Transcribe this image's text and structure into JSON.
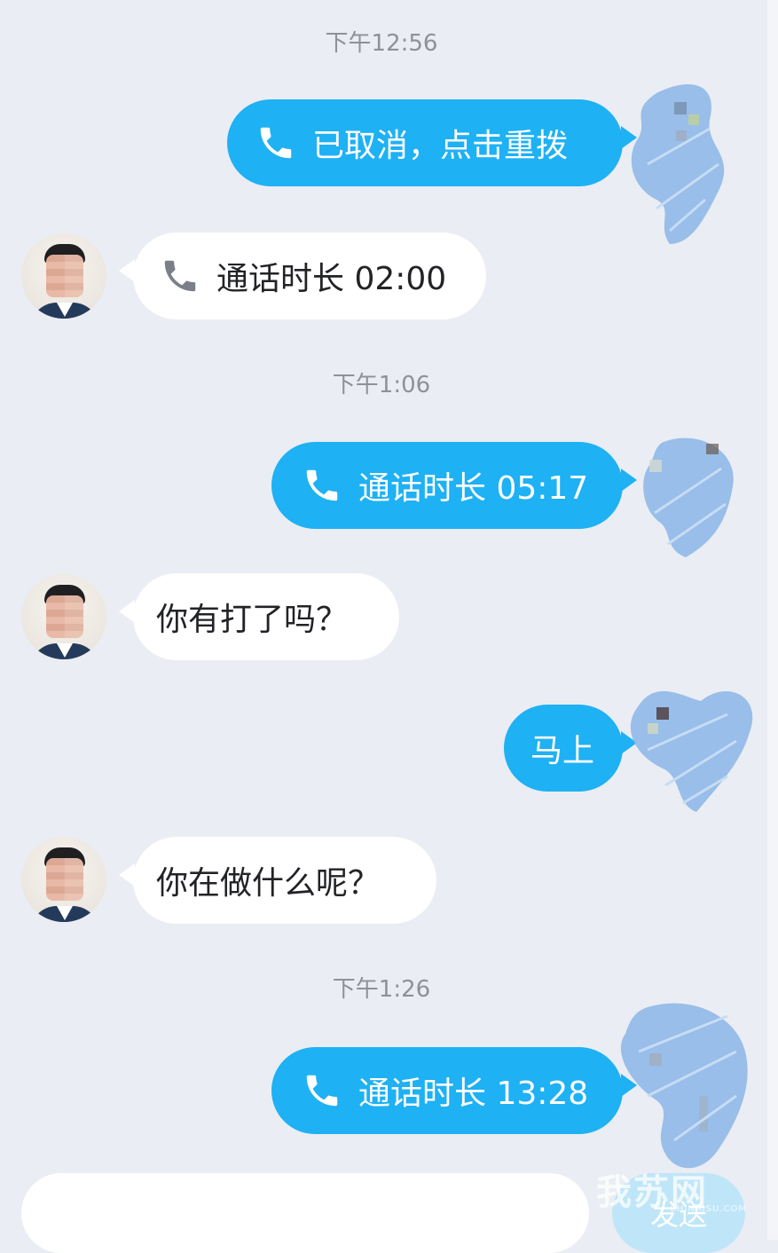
{
  "chat": {
    "timestamps": [
      "下午12:56",
      "下午1:06",
      "下午1:26"
    ],
    "messages": {
      "m1": "已取消，点击重拨",
      "m2": "通话时长 02:00",
      "m3": "通话时长 05:17",
      "m4": "你有打了吗？",
      "m5": "马上",
      "m6": "你在做什么呢？",
      "m7": "通话时长 13:28"
    }
  },
  "input": {
    "send_label": "发送"
  },
  "watermark": {
    "main": "我苏网",
    "sub": "CHINAJSU.COM"
  },
  "icons": {
    "call": "phone-icon",
    "avatar": "contact-avatar",
    "own_avatar": "own-avatar-redacted"
  },
  "colors": {
    "background": "#eaedf3",
    "outgoing_bubble": "#1eb1f4",
    "incoming_bubble": "#ffffff",
    "timestamp_text": "#8e9198",
    "redaction_scribble": "#8fb8e8"
  }
}
